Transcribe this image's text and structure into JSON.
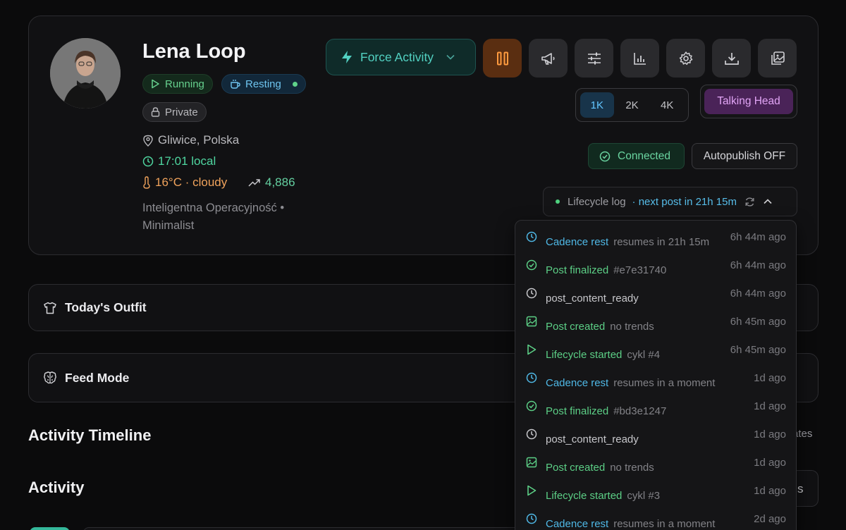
{
  "profile": {
    "name": "Lena Loop",
    "status_running": "Running",
    "status_resting": "Resting",
    "visibility": "Private",
    "location": "Gliwice, Polska",
    "local_time": "17:01 local",
    "weather": "16°C · cloudy",
    "followers": "4,886",
    "tags": "Inteligentna Operacyjność • Minimalist"
  },
  "toolbar": {
    "force_activity": "Force Activity",
    "icons": [
      "pause-icon",
      "megaphone-icon",
      "sliders-icon",
      "chart-icon",
      "gear-icon",
      "download-icon",
      "images-icon"
    ]
  },
  "resolution": {
    "options": [
      "1K",
      "2K",
      "4K"
    ],
    "selected": "1K"
  },
  "mode_label": "Talking Head",
  "connection": {
    "status": "Connected",
    "autopublish": "Autopublish OFF"
  },
  "lifecycle": {
    "label": "Lifecycle log",
    "next": "· next post in 21h 15m"
  },
  "log_entries": [
    {
      "icon": "clock-icon",
      "color": "blue",
      "title": "Cadence rest",
      "sub": "resumes in 21h 15m",
      "time": "6h 44m ago"
    },
    {
      "icon": "check-circle-icon",
      "color": "green",
      "title": "Post finalized",
      "sub": "#e7e31740",
      "time": "6h 44m ago"
    },
    {
      "icon": "clock-icon",
      "color": "gray",
      "title": "post_content_ready",
      "sub": "",
      "time": "6h 44m ago"
    },
    {
      "icon": "image-icon",
      "color": "green",
      "title": "Post created",
      "sub": "no trends",
      "time": "6h 45m ago"
    },
    {
      "icon": "play-icon",
      "color": "green",
      "title": "Lifecycle started",
      "sub": "cykl #4",
      "time": "6h 45m ago"
    },
    {
      "icon": "clock-icon",
      "color": "blue",
      "title": "Cadence rest",
      "sub": "resumes in a moment",
      "time": "1d ago"
    },
    {
      "icon": "check-circle-icon",
      "color": "green",
      "title": "Post finalized",
      "sub": "#bd3e1247",
      "time": "1d ago"
    },
    {
      "icon": "clock-icon",
      "color": "gray",
      "title": "post_content_ready",
      "sub": "",
      "time": "1d ago"
    },
    {
      "icon": "image-icon",
      "color": "green",
      "title": "Post created",
      "sub": "no trends",
      "time": "1d ago"
    },
    {
      "icon": "play-icon",
      "color": "green",
      "title": "Lifecycle started",
      "sub": "cykl #3",
      "time": "1d ago"
    },
    {
      "icon": "clock-icon",
      "color": "blue",
      "title": "Cadence rest",
      "sub": "resumes in a moment",
      "time": "2d ago"
    }
  ],
  "sections": {
    "outfit": "Today's Outfit",
    "feed_mode": "Feed Mode",
    "activity_timeline": "Activity Timeline",
    "activity": "Activity",
    "partial_right_1": "ates",
    "partial_right_2": "s"
  },
  "colors": {
    "background": "#0b0b0c",
    "card": "#111113",
    "accent_teal": "#52d1c2",
    "accent_orange": "#ff9b3f",
    "accent_green": "#5ccf86",
    "accent_blue": "#4fb8e6",
    "accent_purple": "#e2a5f6"
  }
}
